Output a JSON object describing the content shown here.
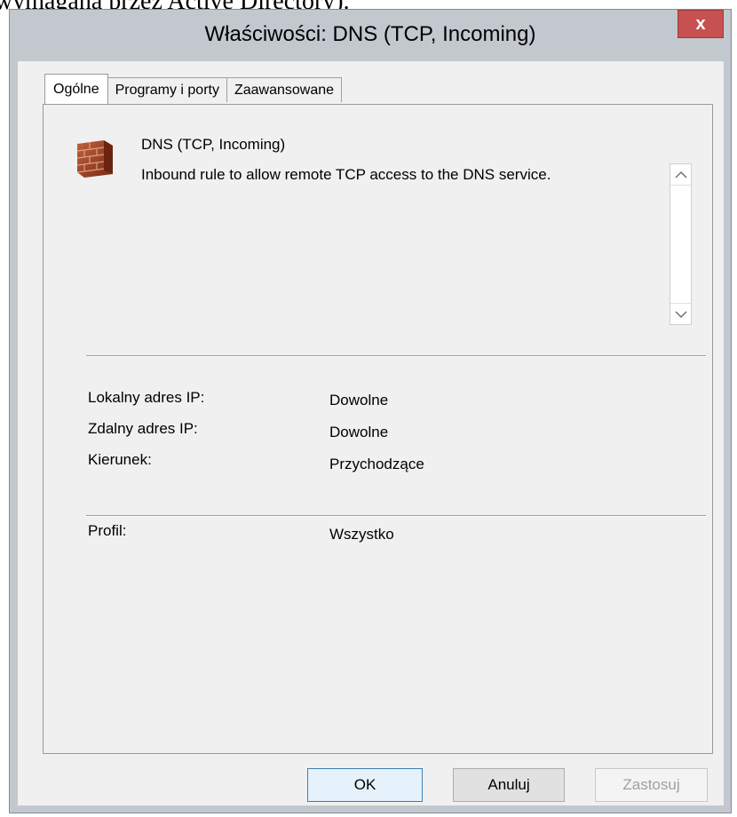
{
  "doc_text": "wymagana przez Active Directory).",
  "window": {
    "title": "Właściwości: DNS (TCP, Incoming)",
    "close_label": "x"
  },
  "tabs": [
    {
      "label": "Ogólne",
      "active": true
    },
    {
      "label": "Programy i porty",
      "active": false
    },
    {
      "label": "Zaawansowane",
      "active": false
    }
  ],
  "rule": {
    "icon": "firewall-brick-icon",
    "name": "DNS (TCP, Incoming)",
    "description": "Inbound rule to allow remote TCP access to the DNS service."
  },
  "scrollbar": {
    "up_glyph": "^",
    "down_glyph": "⌄"
  },
  "fields": [
    {
      "label": "Lokalny adres IP:",
      "value": "Dowolne"
    },
    {
      "label": "Zdalny adres IP:",
      "value": "Dowolne"
    },
    {
      "label": "Kierunek:",
      "value": "Przychodzące"
    }
  ],
  "profile": {
    "label": "Profil:",
    "value": "Wszystko"
  },
  "buttons": {
    "ok": "OK",
    "cancel": "Anuluj",
    "apply": "Zastosuj"
  }
}
